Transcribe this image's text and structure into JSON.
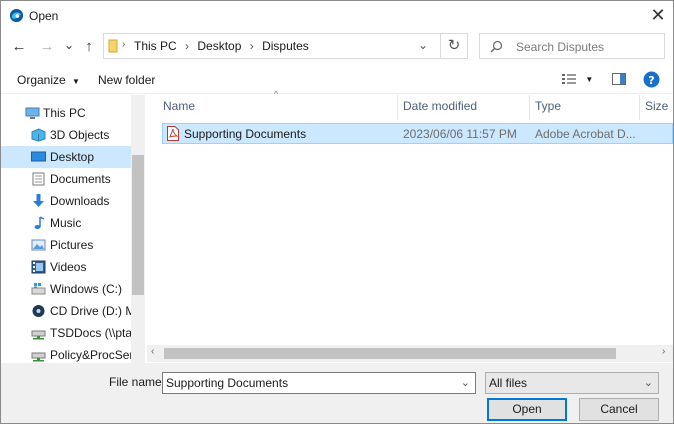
{
  "window": {
    "title": "Open",
    "close_glyph": "✕"
  },
  "nav": {
    "back": "←",
    "forward": "→",
    "recent": "⌄",
    "up": "↑",
    "refresh": "↻"
  },
  "breadcrumb": [
    "This PC",
    "Desktop",
    "Disputes"
  ],
  "search": {
    "placeholder": "Search Disputes"
  },
  "toolbar": {
    "organize": "Organize",
    "new_folder": "New folder"
  },
  "sidebar": {
    "items": [
      {
        "label": "This PC",
        "icon": "computer-icon"
      },
      {
        "label": "3D Objects",
        "icon": "cube-icon"
      },
      {
        "label": "Desktop",
        "icon": "desktop-icon",
        "selected": true
      },
      {
        "label": "Documents",
        "icon": "documents-icon"
      },
      {
        "label": "Downloads",
        "icon": "download-icon"
      },
      {
        "label": "Music",
        "icon": "music-icon"
      },
      {
        "label": "Pictures",
        "icon": "pictures-icon"
      },
      {
        "label": "Videos",
        "icon": "videos-icon"
      },
      {
        "label": "Windows (C:)",
        "icon": "drive-icon"
      },
      {
        "label": "CD Drive (D:) Mc",
        "icon": "cd-drive-icon"
      },
      {
        "label": "TSDDocs (\\\\ptab",
        "icon": "network-drive-icon"
      },
      {
        "label": "Policy&ProcServ",
        "icon": "network-drive-icon"
      }
    ]
  },
  "columns": {
    "name": "Name",
    "date": "Date modified",
    "type": "Type",
    "size": "Size"
  },
  "files": [
    {
      "name": "Supporting Documents",
      "date": "2023/06/06 11:57 PM",
      "type": "Adobe Acrobat D...",
      "icon": "pdf-icon"
    }
  ],
  "bottom": {
    "file_name_label": "File name:",
    "file_name_value": "Supporting Documents",
    "filter_value": "All files",
    "open_label": "Open",
    "cancel_label": "Cancel"
  },
  "colors": {
    "selection": "#cce8ff",
    "accent": "#0078d7",
    "help": "#1a6fc9"
  }
}
